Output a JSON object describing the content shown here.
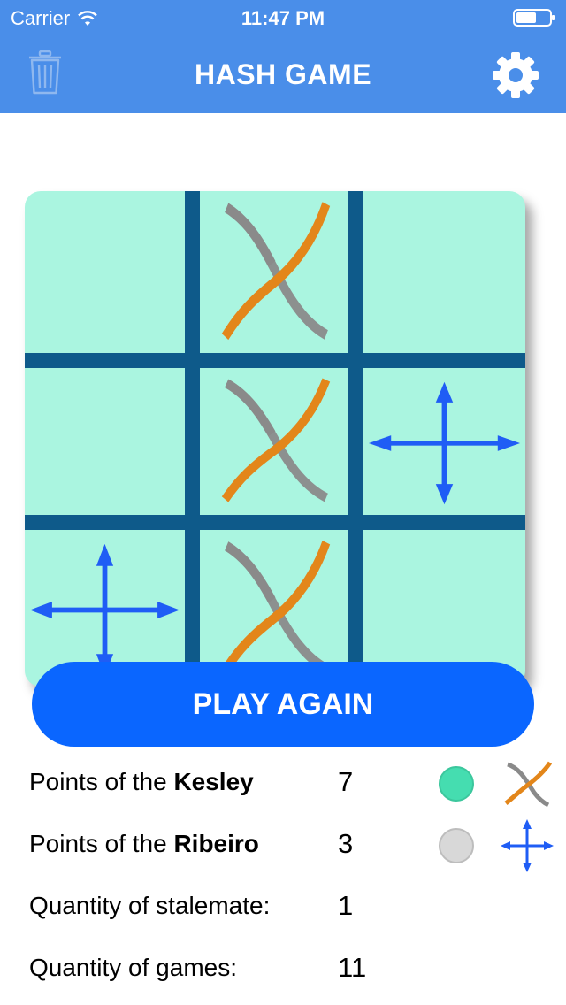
{
  "status_bar": {
    "carrier": "Carrier",
    "time": "11:47 PM"
  },
  "nav": {
    "title": "HASH GAME",
    "left_icon": "trash-icon",
    "right_icon": "gear-icon"
  },
  "board": {
    "background": "#aaf5e0",
    "grid_color": "#0e5a8a",
    "cells": [
      "",
      "x",
      "",
      "",
      "x",
      "o",
      "o",
      "x",
      ""
    ],
    "marks": {
      "x": "crossed-curves-icon",
      "o": "four-way-arrows-icon"
    },
    "x_colors": [
      "#e3861a",
      "#8a8a8a"
    ],
    "o_color": "#1f5df5"
  },
  "play_again_label": "PLAY AGAIN",
  "stats": {
    "player1": {
      "label_prefix": "Points of the ",
      "name": "Kesley",
      "value": "7",
      "dot_color": "#45ddb0",
      "mark": "crossed-curves-icon"
    },
    "player2": {
      "label_prefix": "Points of the ",
      "name": "Ribeiro",
      "value": "3",
      "dot_color": "#d8d8d8",
      "mark": "four-way-arrows-icon"
    },
    "stalemate": {
      "label": "Quantity of stalemate:",
      "value": "1"
    },
    "games": {
      "label": "Quantity of games:",
      "value": "11"
    }
  },
  "colors": {
    "header": "#4a8ee9",
    "button": "#0a66ff"
  }
}
